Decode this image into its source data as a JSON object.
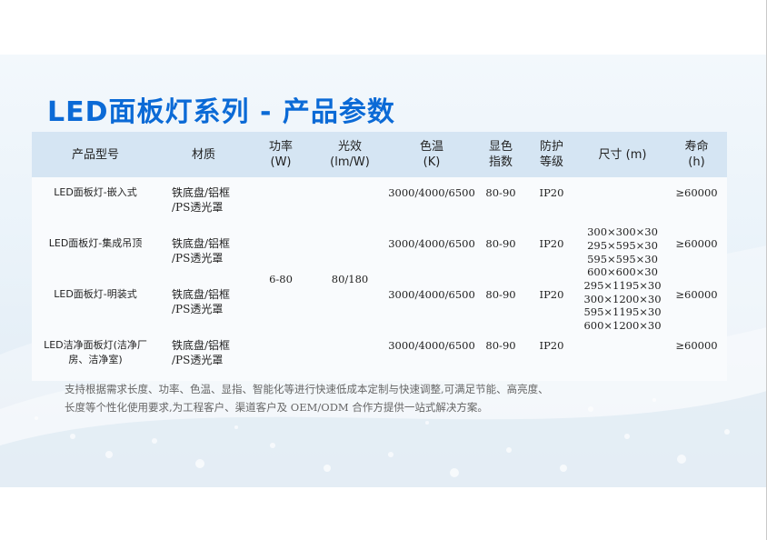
{
  "title": "LED面板灯系列 - 产品参数",
  "table": {
    "headers": [
      {
        "line1": "产品型号",
        "line2": ""
      },
      {
        "line1": "材质",
        "line2": ""
      },
      {
        "line1": "功率",
        "line2": "(W)"
      },
      {
        "line1": "光效",
        "line2": "(lm/W)"
      },
      {
        "line1": "色温",
        "line2": "(K)"
      },
      {
        "line1": "显色",
        "line2": "指数"
      },
      {
        "line1": "防护",
        "line2": "等级"
      },
      {
        "line1": "尺寸 (m)",
        "line2": ""
      },
      {
        "line1": "寿命",
        "line2": "(h)"
      }
    ],
    "power": "6-80",
    "efficacy": "80/180",
    "sizes": [
      "300×300×30",
      "295×595×30",
      "595×595×30",
      "600×600×30",
      "295×1195×30",
      "300×1200×30",
      "595×1195×30",
      "600×1200×30"
    ],
    "rows": [
      {
        "model": "LED面板灯-嵌入式",
        "material": "铁底盘/铝框\n/PS透光罩",
        "cct": "3000/4000/6500",
        "cri": "80-90",
        "ip": "IP20",
        "life": "≥60000"
      },
      {
        "model": "LED面板灯-集成吊顶",
        "material": "铁底盘/铝框\n/PS透光罩",
        "cct": "3000/4000/6500",
        "cri": "80-90",
        "ip": "IP20",
        "life": "≥60000"
      },
      {
        "model": "LED面板灯-明装式",
        "material": "铁底盘/铝框\n/PS透光罩",
        "cct": "3000/4000/6500",
        "cri": "80-90",
        "ip": "IP20",
        "life": "≥60000"
      },
      {
        "model": "LED洁净面板灯(洁净厂\n房、洁净室)",
        "material": "铁底盘/铝框\n/PS透光罩",
        "cct": "3000/4000/6500",
        "cri": "80-90",
        "ip": "IP20",
        "life": "≥60000"
      }
    ]
  },
  "description": {
    "line1": "支持根据需求长度、功率、色温、显指、智能化等进行快速低成本定制与快速调整,可满足节能、高亮度、",
    "line2": "长度等个性化使用要求,为工程客户、渠道客户及 OEM/ODM 合作方提供一站式解决方案。"
  }
}
